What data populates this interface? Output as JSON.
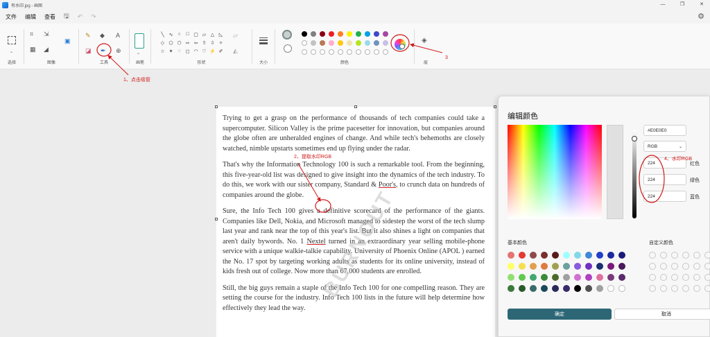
{
  "window": {
    "title": "有水印.jpg - 画图"
  },
  "menu": {
    "file": "文件",
    "edit": "编辑",
    "view": "查看"
  },
  "ribbon": {
    "groups": {
      "select": "选择",
      "image": "图像",
      "tools": "工具",
      "brush": "画笔",
      "shapes": "形状",
      "size": "大小",
      "colors": "颜色",
      "layers": "层"
    }
  },
  "palette": {
    "row1": [
      "#000000",
      "#7f7f7f",
      "#880015",
      "#ed1c24",
      "#ff7f27",
      "#fff200",
      "#22b14c",
      "#00a2e8",
      "#3f48cc",
      "#a349a4"
    ],
    "row2": [
      "#ffffff",
      "#c3c3c3",
      "#b97a57",
      "#ffaec9",
      "#ffc90e",
      "#efe4b0",
      "#b5e61d",
      "#99d9ea",
      "#7092be",
      "#c8bfe7"
    ],
    "row3_empty": 10
  },
  "document": {
    "p1": "Trying to get a grasp on the performance of thousands of tech companies could take a supercomputer. Silicon Valley is the prime pacesetter for innovation, but companies around the globe often are unheralded engines of change. And while tech's behemoths are closely watched, nimble upstarts sometimes end up flying under the radar.",
    "p2a": "That's why the Information Technology 100 is such a remarkable tool. From the beginning, this five-year-old list was designed to give insight into the dynamics of the tech industry. To do this, we work with our sister company, Standard & ",
    "p2_link": "Poor's",
    "p2b": ", to crunch data on hundreds of companies around the globe.",
    "p3a": "Sure, the Info Tech 100 gives a definitive scorecard of the performance of the giants. Companies like Dell, Nokia, and Microsoft managed to sidestep the worst of the tech slump last year and rank near the top of this year's list. But it also shines a light on companies that aren't daily bywords. No. 1 ",
    "p3_link": "Nextel",
    "p3b": " turned in an extraordinary year selling mobile-phone service with a unique walkie-talkie capability. University of Phoenix Online (APOL ) earned the No. 17 spot by targeting working adults as students for its online university, instead of kids fresh out of college. Now more than 67,000 students are enrolled.",
    "p4": "Still, the big guys remain a staple of the Info Tech 100 for one compelling reason. They are setting the course for the industry. Info Tech 100 lists in the future will help determine how effectively they lead the way."
  },
  "dialog": {
    "title": "编辑颜色",
    "hex_value": "#E0E0E0",
    "mode": "RGB",
    "red_value": "224",
    "green_value": "224",
    "blue_value": "224",
    "red_label": "红色",
    "green_label": "绿色",
    "blue_label": "蓝色",
    "basic_colors_label": "基本颜色",
    "custom_colors_label": "自定义颜色",
    "ok": "确定",
    "cancel": "取消",
    "basic_colors": [
      [
        "#e57373",
        "#e53935",
        "#8d4b4b",
        "#7a2f2f",
        "#5a1a1a",
        "#a0ffff",
        "#7fd8e8",
        "#3f88d8",
        "#2040c8",
        "#1a2aa0",
        "#1a1a7a"
      ],
      [
        "#ffff66",
        "#f4e04d",
        "#e0a050",
        "#e07a40",
        "#a0a050",
        "#6aa0a0",
        "#8a5adf",
        "#7030c0",
        "#1a2e70",
        "#7a1a7a",
        "#4a1a5a"
      ],
      [
        "#90e070",
        "#60c850",
        "#40a870",
        "#3a8a3a",
        "#4a6a2a",
        "#a0a0a0",
        "#d070d0",
        "#b040c0",
        "#e070a0",
        "#7a3a7a",
        "#5a2a6a"
      ],
      [
        "#3a7a3a",
        "#2a5a2a",
        "#3a6a6a",
        "#1a4a5a",
        "#2a2a5a",
        "#3a2a6a",
        "#000000",
        "#505050",
        "#a0a0a0",
        "#ffffff",
        "#ffffff"
      ]
    ]
  },
  "annotations": {
    "a1": "1、点击吸管",
    "a2": "2、提取水印RGB",
    "a3": "3",
    "a4": "4、水印RGB"
  },
  "watermark": "BURNOUT"
}
